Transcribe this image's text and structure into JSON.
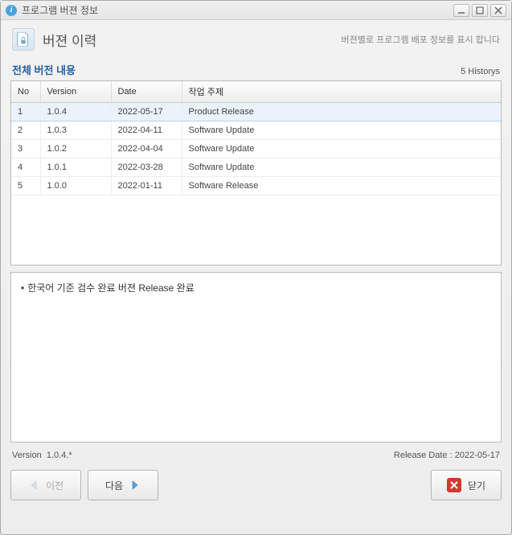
{
  "window": {
    "title": "프로그램 버젼 정보"
  },
  "header": {
    "title": "버젼 이력",
    "subtitle": "버젼별로 프로그램 배포 정보를 표시 합니다"
  },
  "section": {
    "title": "전체 버전 내용",
    "count_label": "5 Historys"
  },
  "table": {
    "columns": {
      "no": "No",
      "version": "Version",
      "date": "Date",
      "subject": "작업 주제"
    },
    "rows": [
      {
        "no": "1",
        "version": "1.0.4",
        "date": "2022-05-17",
        "subject": "Product Release",
        "selected": true
      },
      {
        "no": "2",
        "version": "1.0.3",
        "date": "2022-04-11",
        "subject": "Software Update",
        "selected": false
      },
      {
        "no": "3",
        "version": "1.0.2",
        "date": "2022-04-04",
        "subject": "Software Update",
        "selected": false
      },
      {
        "no": "4",
        "version": "1.0.1",
        "date": "2022-03-28",
        "subject": "Software Update",
        "selected": false
      },
      {
        "no": "5",
        "version": "1.0.0",
        "date": "2022-01-11",
        "subject": "Software Release",
        "selected": false
      }
    ]
  },
  "details": {
    "text": "한국어 기준 검수 완료 버젼 Release 완료"
  },
  "footer": {
    "version_label": "Version",
    "version_value": "1.0.4.*",
    "release_label": "Release Date :",
    "release_value": "2022-05-17"
  },
  "buttons": {
    "prev": "이전",
    "next": "다음",
    "close": "닫기"
  }
}
